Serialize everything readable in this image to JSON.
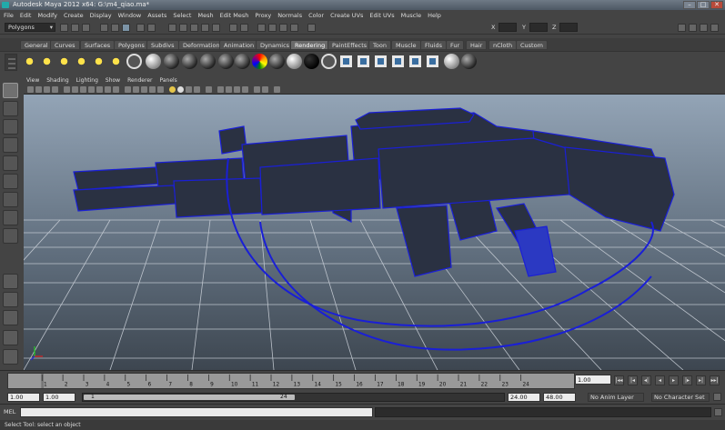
{
  "window": {
    "title": "Autodesk Maya 2012 x64: G:\\m4_qiao.ma*",
    "buttons": [
      "–",
      "□",
      "✕"
    ]
  },
  "menubar": {
    "items": [
      "File",
      "Edit",
      "Modify",
      "Create",
      "Display",
      "Window",
      "Assets",
      "Select",
      "Mesh",
      "Edit Mesh",
      "Proxy",
      "Normals",
      "Color",
      "Create UVs",
      "Edit UVs",
      "Muscle",
      "Help"
    ]
  },
  "statusline": {
    "mode": "Polygons"
  },
  "shelf": {
    "tabs": [
      "General",
      "Curves",
      "Surfaces",
      "Polygons",
      "Subdivs",
      "Deformation",
      "Animation",
      "Dynamics",
      "Rendering",
      "PaintEffects",
      "Toon",
      "Muscle",
      "Fluids",
      "Fur",
      "Hair",
      "nCloth",
      "Custom"
    ],
    "active_tab": "Rendering"
  },
  "viewport_panel": {
    "menu": [
      "View",
      "Shading",
      "Lighting",
      "Show",
      "Renderer",
      "Panels"
    ]
  },
  "timeslider": {
    "ticks": [
      "1",
      "2",
      "3",
      "4",
      "5",
      "6",
      "7",
      "8",
      "9",
      "10",
      "11",
      "12",
      "13",
      "14",
      "15",
      "16",
      "17",
      "18",
      "19",
      "20",
      "21",
      "22",
      "23",
      "24"
    ],
    "current_frame": "1.00",
    "playback_icons": [
      "|◂◂",
      "|◂",
      "◂|",
      "◂",
      "▸",
      "|▸",
      "▸|",
      "▸▸|"
    ]
  },
  "rangeslider": {
    "start_time": "1.00",
    "playback_start": "1.00",
    "slider_start": "1",
    "slider_end": "24",
    "playback_end": "24.00",
    "end_time": "48.00",
    "anim_layer": "No Anim Layer",
    "character_set": "No Character Set"
  },
  "commandline": {
    "label": "MEL"
  },
  "helpline": {
    "text": "Select Tool: select an object"
  },
  "colors": {
    "wireframe": "#1a1fd6",
    "viewport_top": "#93a4b6",
    "viewport_bottom": "#3d4650",
    "ui_bg": "#444444"
  }
}
